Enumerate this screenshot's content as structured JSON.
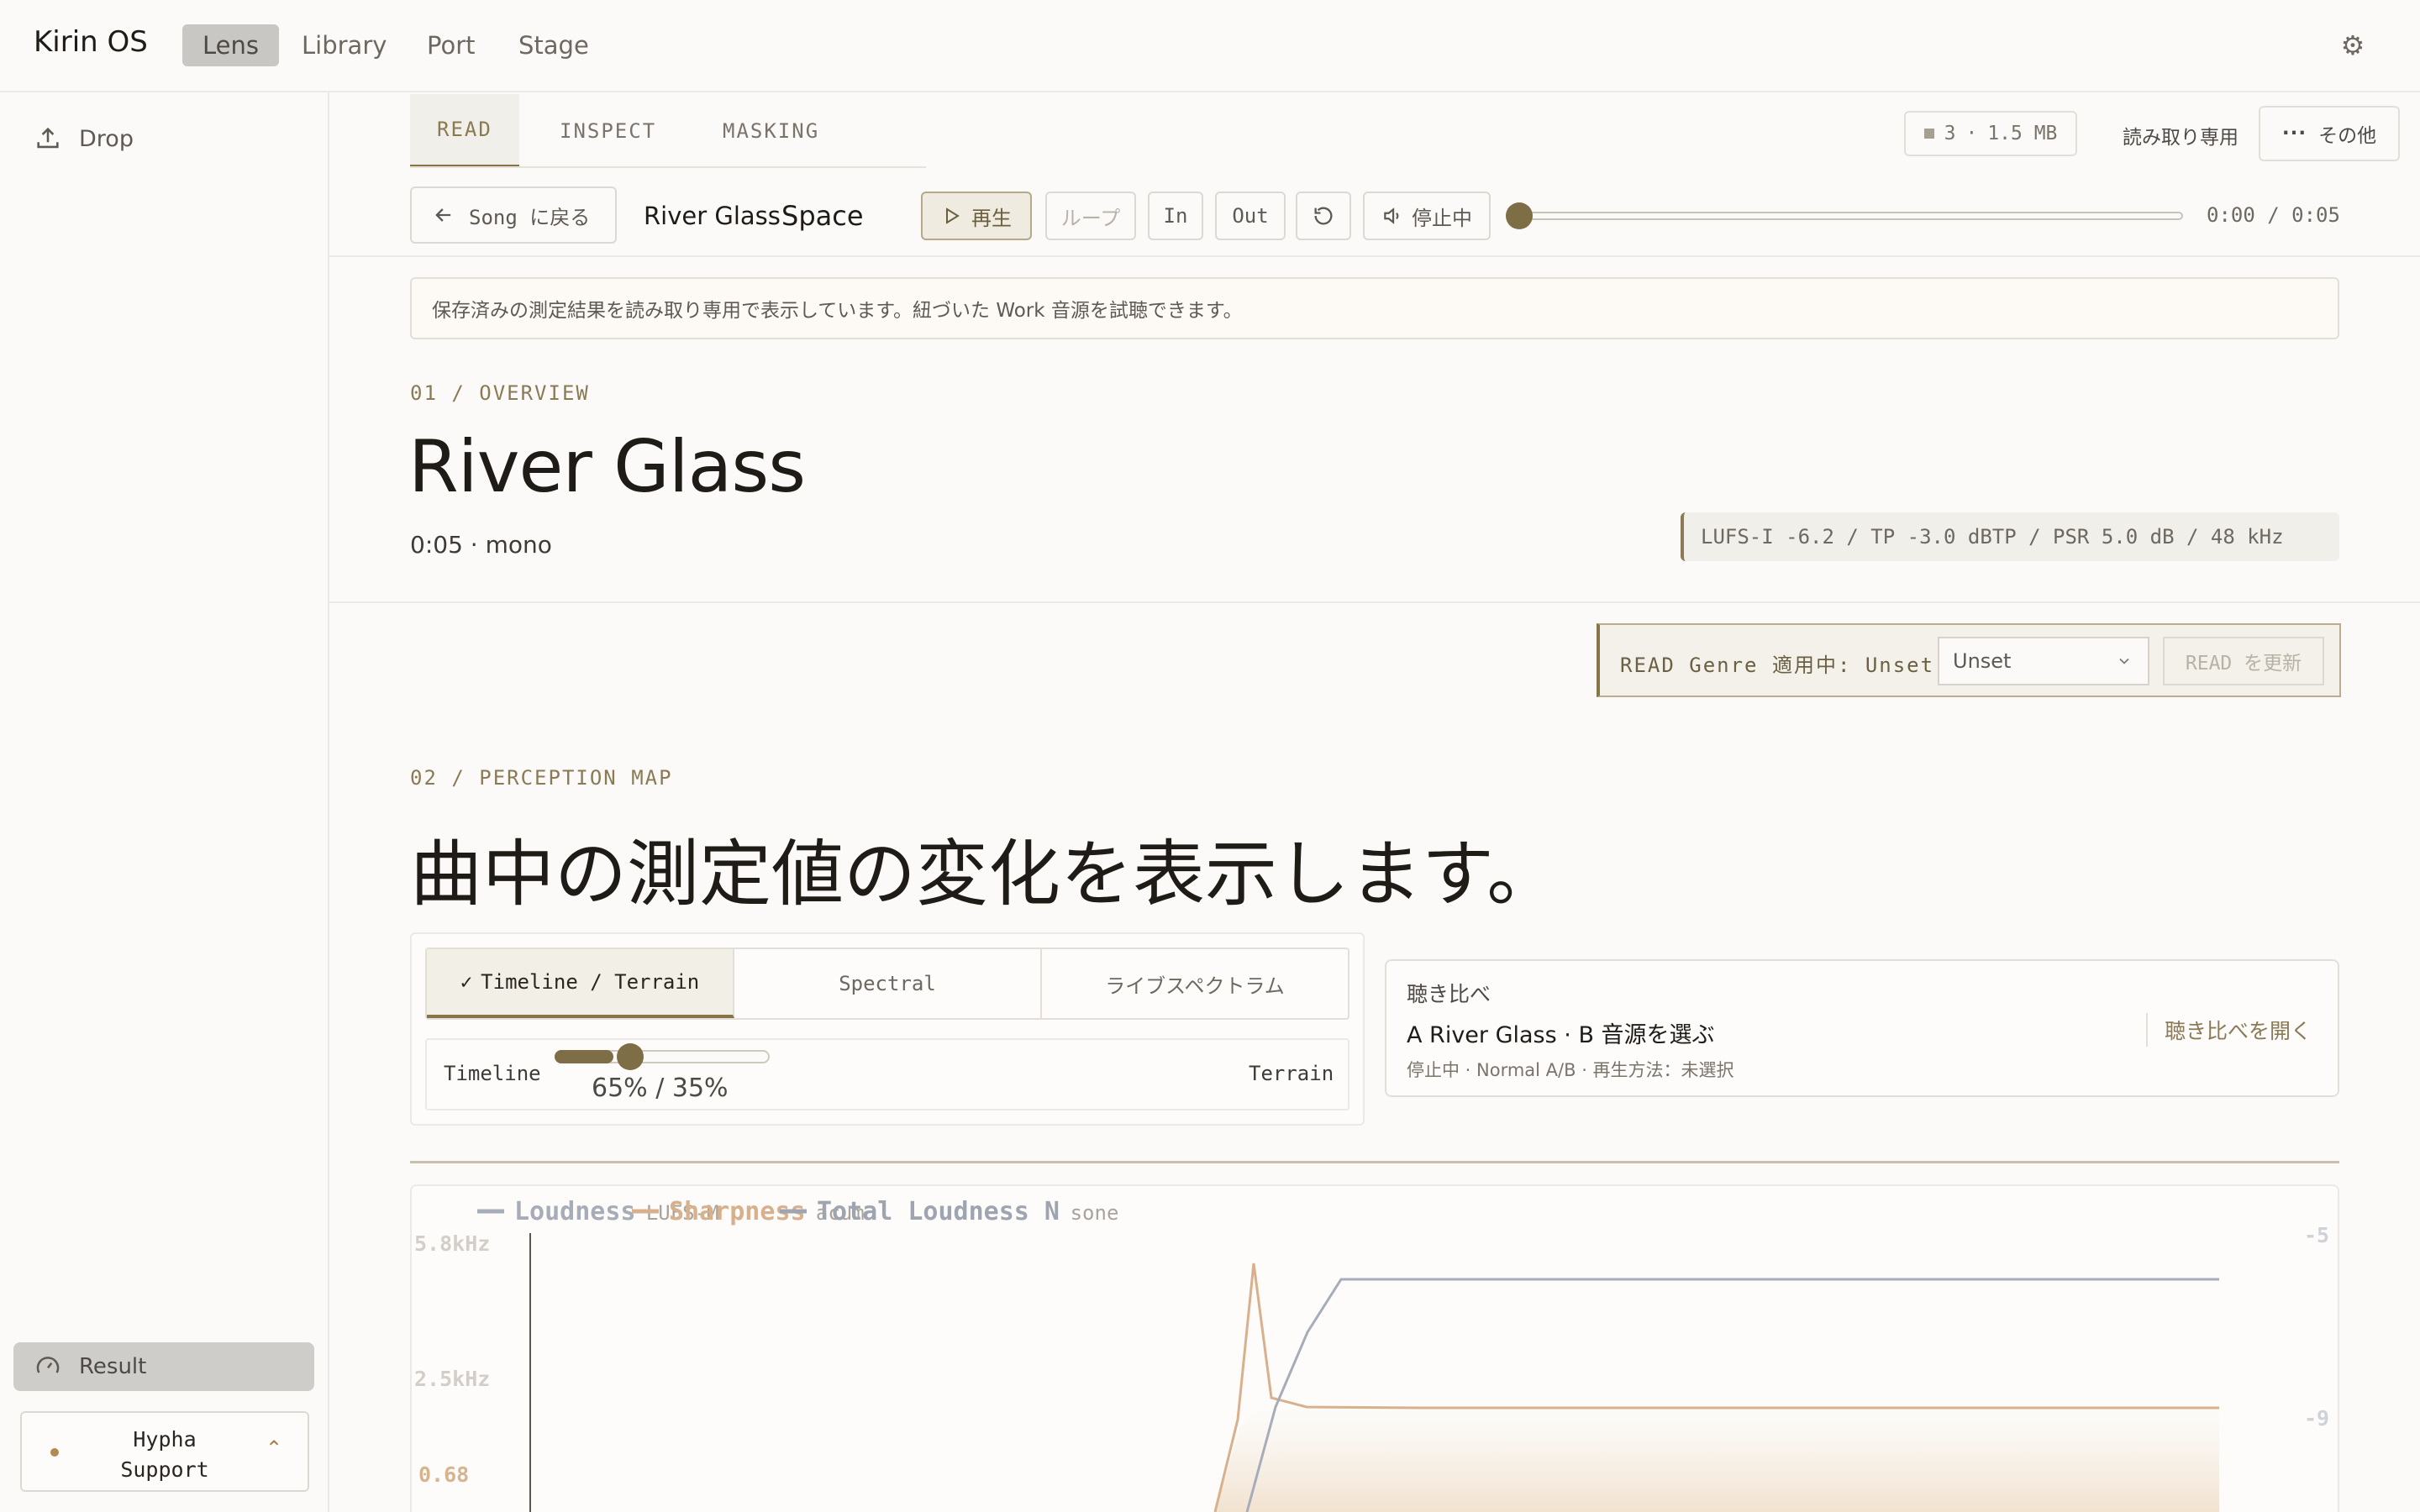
{
  "app": {
    "name": "Kirin OS"
  },
  "nav": {
    "items": [
      "Lens",
      "Library",
      "Port",
      "Stage"
    ],
    "active": "Lens"
  },
  "sidebar": {
    "drop_label": "Drop",
    "result_label": "Result",
    "support_line1": "Hypha",
    "support_line2": "Support",
    "support_chevron": "⌃"
  },
  "tabs": {
    "items": [
      "READ",
      "INSPECT",
      "MASKING"
    ],
    "active": "READ"
  },
  "status": {
    "count": "3",
    "size": "1.5 MB",
    "mode": "読み取り専用",
    "more": "その他"
  },
  "transport": {
    "back": "Song に戻る",
    "song_title": "River Glass",
    "space": "Space",
    "play": "再生",
    "loop": "ループ",
    "in": "In",
    "out": "Out",
    "mute": "停止中",
    "position": 0.0,
    "time": "0:00 / 0:05"
  },
  "banner": "保存済みの測定結果を読み取り専用で表示しています。紐づいた Work 音源を試聴できます。",
  "overview": {
    "label": "01 / OVERVIEW",
    "title": "River Glass",
    "subtitle": "0:05 · mono",
    "metrics": "LUFS-I -6.2 / TP -3.0 dBTP / PSR 5.0 dB / 48 kHz"
  },
  "genre": {
    "label": "READ Genre 適用中: Unset",
    "selected": "Unset",
    "update": "READ を更新"
  },
  "perception": {
    "label": "02 / PERCEPTION MAP",
    "title": "曲中の測定値の変化を表示します。",
    "modes": [
      "Timeline / Terrain",
      "Spectral",
      "ライブスペクトラム"
    ],
    "active_mode": "Timeline / Terrain",
    "mix_left": "Timeline",
    "mix_right": "Terrain",
    "mix_value": 0.65,
    "mix_readout": "65% / 35%"
  },
  "compare": {
    "heading": "聴き比べ",
    "title": "A River Glass · B 音源を選ぶ",
    "sub": "停止中 · Normal A/B · 再生方法：未選択",
    "open": "聴き比べを開く"
  },
  "chart_data": {
    "type": "line",
    "legend": [
      {
        "name": "Loudness",
        "unit": "LUFS-M",
        "color": "#a7adb8"
      },
      {
        "name": "Sharpness",
        "unit": "acum",
        "color": "#d9b08c"
      },
      {
        "name": "Total Loudness N",
        "unit": "sone",
        "color": "#9fa5b0"
      }
    ],
    "left_ticks": [
      "5.8kHz",
      "2.5kHz",
      "0.68"
    ],
    "right_ticks": [
      "-5",
      "-9"
    ],
    "colors": {
      "loudness": "#a7adb8",
      "sharpness": "#d9b08c",
      "axis": "#5a5650"
    }
  }
}
